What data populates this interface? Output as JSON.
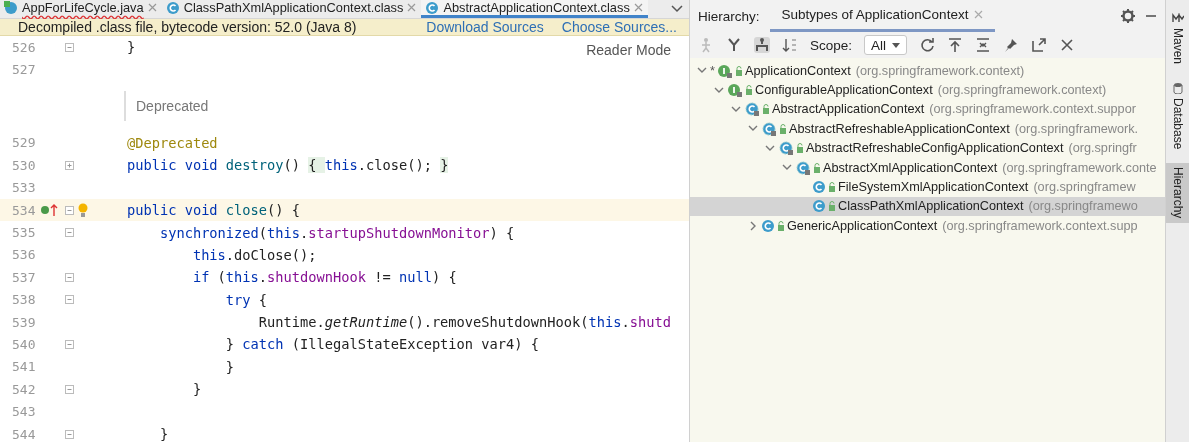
{
  "editor_tabs": [
    {
      "label": "AppForLifeCycle.java",
      "kind": "java",
      "selected": false,
      "error": true
    },
    {
      "label": "ClassPathXmlApplicationContext.class",
      "kind": "class",
      "selected": false,
      "error": false
    },
    {
      "label": "AbstractApplicationContext.class",
      "kind": "class",
      "selected": true,
      "error": false
    }
  ],
  "banner": {
    "message": "Decompiled .class file, bytecode version: 52.0 (Java 8)",
    "links": [
      "Download Sources",
      "Choose Sources..."
    ]
  },
  "reader_mode": "Reader Mode",
  "code_lines": [
    {
      "kind": "code",
      "number": "526",
      "fold_marker": true,
      "tokens": [
        {
          "text": "    }",
          "kind": "plain"
        }
      ]
    },
    {
      "kind": "code",
      "number": "527"
    },
    {
      "kind": "doc",
      "text": "Deprecated"
    },
    {
      "kind": "code",
      "number": "529",
      "tokens": [
        {
          "text": "    @Deprecated",
          "kind": "annotation"
        }
      ]
    },
    {
      "kind": "code",
      "number": "530",
      "fold_marker": true,
      "folded": true,
      "tokens": [
        {
          "text": "    public void ",
          "kind": "keyword"
        },
        {
          "text": "destroy",
          "kind": "method"
        },
        {
          "text": "() ",
          "kind": "plain"
        },
        {
          "text": "{ ",
          "kind": "folded"
        },
        {
          "text": "this",
          "kind": "keyword"
        },
        {
          "text": ".close(); ",
          "kind": "plain"
        },
        {
          "text": "}",
          "kind": "folded"
        }
      ]
    },
    {
      "kind": "code",
      "number": "533"
    },
    {
      "kind": "code",
      "number": "534",
      "fold_marker": true,
      "current": true,
      "overrides": true,
      "bulb": true,
      "tokens": [
        {
          "text": "    public void ",
          "kind": "keyword"
        },
        {
          "text": "close",
          "kind": "method"
        },
        {
          "text": "() {",
          "kind": "plain"
        }
      ]
    },
    {
      "kind": "code",
      "number": "535",
      "fold_marker": true,
      "tokens": [
        {
          "text": "        synchronized",
          "kind": "keyword"
        },
        {
          "text": "(",
          "kind": "plain"
        },
        {
          "text": "this",
          "kind": "keyword"
        },
        {
          "text": ".",
          "kind": "plain"
        },
        {
          "text": "startupShutdownMonitor",
          "kind": "field"
        },
        {
          "text": ") {",
          "kind": "plain"
        }
      ]
    },
    {
      "kind": "code",
      "number": "536",
      "tokens": [
        {
          "text": "            this",
          "kind": "keyword"
        },
        {
          "text": ".doClose();",
          "kind": "plain"
        }
      ]
    },
    {
      "kind": "code",
      "number": "537",
      "fold_marker": true,
      "tokens": [
        {
          "text": "            if",
          "kind": "keyword"
        },
        {
          "text": " (",
          "kind": "plain"
        },
        {
          "text": "this",
          "kind": "keyword"
        },
        {
          "text": ".",
          "kind": "plain"
        },
        {
          "text": "shutdownHook",
          "kind": "field"
        },
        {
          "text": " != ",
          "kind": "plain"
        },
        {
          "text": "null",
          "kind": "keyword"
        },
        {
          "text": ") {",
          "kind": "plain"
        }
      ]
    },
    {
      "kind": "code",
      "number": "538",
      "fold_marker": true,
      "tokens": [
        {
          "text": "                try",
          "kind": "keyword"
        },
        {
          "text": " {",
          "kind": "plain"
        }
      ]
    },
    {
      "kind": "code",
      "number": "539",
      "tokens": [
        {
          "text": "                    Runtime.",
          "kind": "plain"
        },
        {
          "text": "getRuntime",
          "kind": "static"
        },
        {
          "text": "().removeShutdownHook(",
          "kind": "plain"
        },
        {
          "text": "this",
          "kind": "keyword"
        },
        {
          "text": ".",
          "kind": "plain"
        },
        {
          "text": "shutd",
          "kind": "field"
        }
      ]
    },
    {
      "kind": "code",
      "number": "540",
      "fold_marker": true,
      "tokens": [
        {
          "text": "                } ",
          "kind": "plain"
        },
        {
          "text": "catch",
          "kind": "keyword"
        },
        {
          "text": " (IllegalStateException var4) {",
          "kind": "plain"
        }
      ]
    },
    {
      "kind": "code",
      "number": "541",
      "tokens": [
        {
          "text": "                }",
          "kind": "plain"
        }
      ]
    },
    {
      "kind": "code",
      "number": "542",
      "fold_marker": true,
      "tokens": [
        {
          "text": "            }",
          "kind": "plain"
        }
      ]
    },
    {
      "kind": "code",
      "number": "543"
    },
    {
      "kind": "code",
      "number": "544",
      "fold_marker": true,
      "tokens": [
        {
          "text": "        }",
          "kind": "plain"
        }
      ]
    }
  ],
  "hierarchy": {
    "label": "Hierarchy:",
    "tab": {
      "label": "Subtypes of ApplicationContext",
      "selected": true
    },
    "scope_label": "Scope:",
    "scope_value": "All",
    "tree": [
      {
        "name": "ApplicationContext",
        "package": "(org.springframework.context)",
        "kind": "interface",
        "marker": "*",
        "expanded": true,
        "selected": false,
        "children": [
          {
            "name": "ConfigurableApplicationContext",
            "package": "(org.springframework.context)",
            "kind": "interface",
            "expanded": true,
            "selected": false,
            "children": [
              {
                "name": "AbstractApplicationContext",
                "package": "(org.springframework.context.suppor",
                "kind": "abstract",
                "expanded": true,
                "selected": false,
                "children": [
                  {
                    "name": "AbstractRefreshableApplicationContext",
                    "package": "(org.springframework.",
                    "kind": "abstract",
                    "expanded": true,
                    "selected": false,
                    "children": [
                      {
                        "name": "AbstractRefreshableConfigApplicationContext",
                        "package": "(org.springfr",
                        "kind": "abstract",
                        "expanded": true,
                        "selected": false,
                        "children": [
                          {
                            "name": "AbstractXmlApplicationContext",
                            "package": "(org.springframework.conte",
                            "kind": "abstract",
                            "expanded": true,
                            "selected": false,
                            "children": [
                              {
                                "name": "FileSystemXmlApplicationContext",
                                "package": "(org.springframew",
                                "kind": "class",
                                "selected": false
                              },
                              {
                                "name": "ClassPathXmlApplicationContext",
                                "package": "(org.springframewo",
                                "kind": "class",
                                "selected": true
                              }
                            ]
                          }
                        ]
                      }
                    ]
                  },
                  {
                    "name": "GenericApplicationContext",
                    "package": "(org.springframework.context.supp",
                    "kind": "class",
                    "expanded": false,
                    "selected": false
                  }
                ]
              }
            ]
          }
        ]
      }
    ]
  },
  "side_tools": [
    {
      "label": "Maven",
      "kind": "maven",
      "selected": false
    },
    {
      "label": "Database",
      "kind": "database",
      "selected": false
    },
    {
      "label": "Hierarchy",
      "kind": "plain",
      "selected": true
    }
  ]
}
